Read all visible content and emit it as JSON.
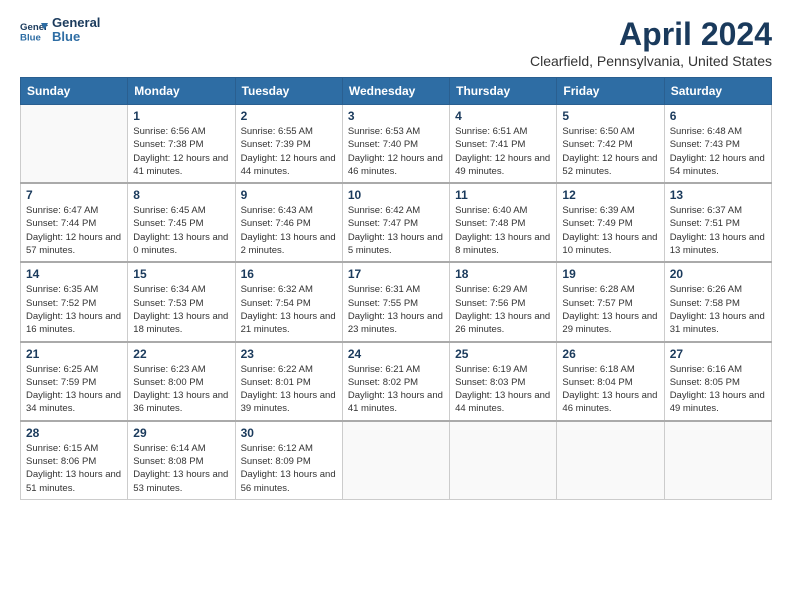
{
  "header": {
    "logo_line1": "General",
    "logo_line2": "Blue",
    "title": "April 2024",
    "subtitle": "Clearfield, Pennsylvania, United States"
  },
  "calendar": {
    "headers": [
      "Sunday",
      "Monday",
      "Tuesday",
      "Wednesday",
      "Thursday",
      "Friday",
      "Saturday"
    ],
    "weeks": [
      [
        {
          "day": "",
          "sunrise": "",
          "sunset": "",
          "daylight": ""
        },
        {
          "day": "1",
          "sunrise": "Sunrise: 6:56 AM",
          "sunset": "Sunset: 7:38 PM",
          "daylight": "Daylight: 12 hours and 41 minutes."
        },
        {
          "day": "2",
          "sunrise": "Sunrise: 6:55 AM",
          "sunset": "Sunset: 7:39 PM",
          "daylight": "Daylight: 12 hours and 44 minutes."
        },
        {
          "day": "3",
          "sunrise": "Sunrise: 6:53 AM",
          "sunset": "Sunset: 7:40 PM",
          "daylight": "Daylight: 12 hours and 46 minutes."
        },
        {
          "day": "4",
          "sunrise": "Sunrise: 6:51 AM",
          "sunset": "Sunset: 7:41 PM",
          "daylight": "Daylight: 12 hours and 49 minutes."
        },
        {
          "day": "5",
          "sunrise": "Sunrise: 6:50 AM",
          "sunset": "Sunset: 7:42 PM",
          "daylight": "Daylight: 12 hours and 52 minutes."
        },
        {
          "day": "6",
          "sunrise": "Sunrise: 6:48 AM",
          "sunset": "Sunset: 7:43 PM",
          "daylight": "Daylight: 12 hours and 54 minutes."
        }
      ],
      [
        {
          "day": "7",
          "sunrise": "Sunrise: 6:47 AM",
          "sunset": "Sunset: 7:44 PM",
          "daylight": "Daylight: 12 hours and 57 minutes."
        },
        {
          "day": "8",
          "sunrise": "Sunrise: 6:45 AM",
          "sunset": "Sunset: 7:45 PM",
          "daylight": "Daylight: 13 hours and 0 minutes."
        },
        {
          "day": "9",
          "sunrise": "Sunrise: 6:43 AM",
          "sunset": "Sunset: 7:46 PM",
          "daylight": "Daylight: 13 hours and 2 minutes."
        },
        {
          "day": "10",
          "sunrise": "Sunrise: 6:42 AM",
          "sunset": "Sunset: 7:47 PM",
          "daylight": "Daylight: 13 hours and 5 minutes."
        },
        {
          "day": "11",
          "sunrise": "Sunrise: 6:40 AM",
          "sunset": "Sunset: 7:48 PM",
          "daylight": "Daylight: 13 hours and 8 minutes."
        },
        {
          "day": "12",
          "sunrise": "Sunrise: 6:39 AM",
          "sunset": "Sunset: 7:49 PM",
          "daylight": "Daylight: 13 hours and 10 minutes."
        },
        {
          "day": "13",
          "sunrise": "Sunrise: 6:37 AM",
          "sunset": "Sunset: 7:51 PM",
          "daylight": "Daylight: 13 hours and 13 minutes."
        }
      ],
      [
        {
          "day": "14",
          "sunrise": "Sunrise: 6:35 AM",
          "sunset": "Sunset: 7:52 PM",
          "daylight": "Daylight: 13 hours and 16 minutes."
        },
        {
          "day": "15",
          "sunrise": "Sunrise: 6:34 AM",
          "sunset": "Sunset: 7:53 PM",
          "daylight": "Daylight: 13 hours and 18 minutes."
        },
        {
          "day": "16",
          "sunrise": "Sunrise: 6:32 AM",
          "sunset": "Sunset: 7:54 PM",
          "daylight": "Daylight: 13 hours and 21 minutes."
        },
        {
          "day": "17",
          "sunrise": "Sunrise: 6:31 AM",
          "sunset": "Sunset: 7:55 PM",
          "daylight": "Daylight: 13 hours and 23 minutes."
        },
        {
          "day": "18",
          "sunrise": "Sunrise: 6:29 AM",
          "sunset": "Sunset: 7:56 PM",
          "daylight": "Daylight: 13 hours and 26 minutes."
        },
        {
          "day": "19",
          "sunrise": "Sunrise: 6:28 AM",
          "sunset": "Sunset: 7:57 PM",
          "daylight": "Daylight: 13 hours and 29 minutes."
        },
        {
          "day": "20",
          "sunrise": "Sunrise: 6:26 AM",
          "sunset": "Sunset: 7:58 PM",
          "daylight": "Daylight: 13 hours and 31 minutes."
        }
      ],
      [
        {
          "day": "21",
          "sunrise": "Sunrise: 6:25 AM",
          "sunset": "Sunset: 7:59 PM",
          "daylight": "Daylight: 13 hours and 34 minutes."
        },
        {
          "day": "22",
          "sunrise": "Sunrise: 6:23 AM",
          "sunset": "Sunset: 8:00 PM",
          "daylight": "Daylight: 13 hours and 36 minutes."
        },
        {
          "day": "23",
          "sunrise": "Sunrise: 6:22 AM",
          "sunset": "Sunset: 8:01 PM",
          "daylight": "Daylight: 13 hours and 39 minutes."
        },
        {
          "day": "24",
          "sunrise": "Sunrise: 6:21 AM",
          "sunset": "Sunset: 8:02 PM",
          "daylight": "Daylight: 13 hours and 41 minutes."
        },
        {
          "day": "25",
          "sunrise": "Sunrise: 6:19 AM",
          "sunset": "Sunset: 8:03 PM",
          "daylight": "Daylight: 13 hours and 44 minutes."
        },
        {
          "day": "26",
          "sunrise": "Sunrise: 6:18 AM",
          "sunset": "Sunset: 8:04 PM",
          "daylight": "Daylight: 13 hours and 46 minutes."
        },
        {
          "day": "27",
          "sunrise": "Sunrise: 6:16 AM",
          "sunset": "Sunset: 8:05 PM",
          "daylight": "Daylight: 13 hours and 49 minutes."
        }
      ],
      [
        {
          "day": "28",
          "sunrise": "Sunrise: 6:15 AM",
          "sunset": "Sunset: 8:06 PM",
          "daylight": "Daylight: 13 hours and 51 minutes."
        },
        {
          "day": "29",
          "sunrise": "Sunrise: 6:14 AM",
          "sunset": "Sunset: 8:08 PM",
          "daylight": "Daylight: 13 hours and 53 minutes."
        },
        {
          "day": "30",
          "sunrise": "Sunrise: 6:12 AM",
          "sunset": "Sunset: 8:09 PM",
          "daylight": "Daylight: 13 hours and 56 minutes."
        },
        {
          "day": "",
          "sunrise": "",
          "sunset": "",
          "daylight": ""
        },
        {
          "day": "",
          "sunrise": "",
          "sunset": "",
          "daylight": ""
        },
        {
          "day": "",
          "sunrise": "",
          "sunset": "",
          "daylight": ""
        },
        {
          "day": "",
          "sunrise": "",
          "sunset": "",
          "daylight": ""
        }
      ]
    ]
  }
}
